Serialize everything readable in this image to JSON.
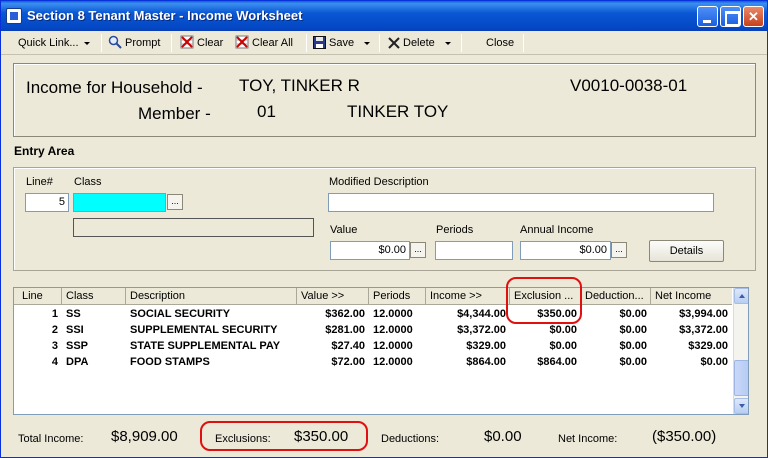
{
  "window": {
    "title": "Section 8 Tenant Master - Income Worksheet"
  },
  "toolbar": {
    "quick_link": "Quick Link...",
    "prompt": "Prompt",
    "clear": "Clear",
    "clear_all": "Clear All",
    "save": "Save",
    "delete": "Delete",
    "close": "Close"
  },
  "header": {
    "income_label": "Income for Household -",
    "household_name": "TOY, TINKER R",
    "account_id": "V0010-0038-01",
    "member_label": "Member -",
    "member_number": "01",
    "member_name": "TINKER TOY"
  },
  "entry": {
    "section_title": "Entry Area",
    "line_label": "Line#",
    "line_value": "5",
    "class_label": "Class",
    "class_value": "",
    "class_desc_value": "",
    "modified_desc_label": "Modified Description",
    "modified_desc_value": "",
    "value_label": "Value",
    "value_value": "$0.00",
    "periods_label": "Periods",
    "periods_value": "",
    "annual_income_label": "Annual Income",
    "annual_income_value": "$0.00",
    "details_button": "Details",
    "ellipsis": "..."
  },
  "grid": {
    "columns": [
      "Line",
      "Class",
      "Description",
      "Value >>",
      "Periods",
      "Income >>",
      "Exclusion ...",
      "Deduction...",
      "Net Income"
    ],
    "rows": [
      {
        "line": "1",
        "class": "SS",
        "description": "SOCIAL SECURITY",
        "value": "$362.00",
        "periods": "12.0000",
        "income": "$4,344.00",
        "exclusion": "$350.00",
        "deduction": "$0.00",
        "net_income": "$3,994.00"
      },
      {
        "line": "2",
        "class": "SSI",
        "description": "SUPPLEMENTAL SECURITY",
        "value": "$281.00",
        "periods": "12.0000",
        "income": "$3,372.00",
        "exclusion": "$0.00",
        "deduction": "$0.00",
        "net_income": "$3,372.00"
      },
      {
        "line": "3",
        "class": "SSP",
        "description": "STATE SUPPLEMENTAL PAY",
        "value": "$27.40",
        "periods": "12.0000",
        "income": "$329.00",
        "exclusion": "$0.00",
        "deduction": "$0.00",
        "net_income": "$329.00"
      },
      {
        "line": "4",
        "class": "DPA",
        "description": "FOOD STAMPS",
        "value": "$72.00",
        "periods": "12.0000",
        "income": "$864.00",
        "exclusion": "$864.00",
        "deduction": "$0.00",
        "net_income": "$0.00"
      }
    ]
  },
  "totals": {
    "total_income_label": "Total Income:",
    "total_income_value": "$8,909.00",
    "exclusions_label": "Exclusions:",
    "exclusions_value": "$350.00",
    "deductions_label": "Deductions:",
    "deductions_value": "$0.00",
    "net_income_label": "Net Income:",
    "net_income_value": "($350.00)"
  },
  "colors": {
    "titlebar": "#0a57d4",
    "window_bg": "#ece9d8",
    "class_field_highlight": "#00ffff",
    "annotation_red": "#e01010"
  }
}
